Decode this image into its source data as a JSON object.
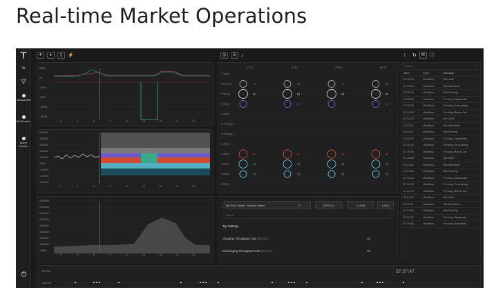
{
  "page": {
    "title": "Real-time Market Operations"
  },
  "nav": {
    "items": [
      {
        "label": "ffa"
      },
      {
        "label": "Manual Bid"
      },
      {
        "label": "Bid Monitor"
      },
      {
        "label": "Alarm Monitor"
      }
    ]
  },
  "chart_top": {
    "ylabels": [
      "800$",
      "0$",
      "-400$",
      "-800$",
      "-1200$",
      "-1600$"
    ],
    "xlabels": [
      "0",
      "3",
      "6",
      "9",
      "12",
      "15",
      "18",
      "21",
      "24"
    ]
  },
  "chart_mid": {
    "ylabels": [
      "500MW",
      "400MW",
      "300MW",
      "200MW",
      "100MW",
      "0MW",
      "-100MW",
      "-200MW",
      "-300MW"
    ],
    "xlabels": [
      "0",
      "3",
      "6",
      "9",
      "12",
      "15",
      "18",
      "21",
      "24"
    ]
  },
  "chart_bottom": {
    "ylabels": [
      "800MWh",
      "700MWh",
      "600MWh",
      "500MWh",
      "400MWh",
      "300MWh",
      "200MWh",
      "100MWh",
      "0MWh"
    ],
    "xlabels": [
      "0",
      "3",
      "6",
      "9",
      "12",
      "15",
      "18",
      "21",
      "24"
    ]
  },
  "bid_grid": {
    "columns": [
      "07:30",
      "07:45",
      "07:45",
      "08:00"
    ],
    "rows": [
      "S Soc(-)",
      "P/Pmax(-)",
      "P/Soc(-)",
      "S avg(-)",
      "S avg(-)",
      "E energy(-)",
      "E energy(-)",
      "L avg(-)",
      "L avg(-)",
      "L Soc(-)",
      "L Soc(-)",
      "L Soc(-)"
    ],
    "cells": [
      {
        "r": 1,
        "v": [
          "-1",
          "14",
          "-1",
          "14"
        ]
      },
      {
        "r": 2,
        "v": [
          "62",
          "63",
          "63",
          "63"
        ]
      },
      {
        "r": 3,
        "v": [
          "",
          "30",
          "",
          "30"
        ]
      },
      {
        "r": 8,
        "v": [
          "40",
          "40",
          "40",
          "40"
        ]
      },
      {
        "r": 9,
        "v": [
          "40",
          "40",
          "40",
          "40"
        ]
      },
      {
        "r": 10,
        "v": [
          "15",
          "15",
          "15",
          "15"
        ]
      }
    ]
  },
  "scenario": {
    "select": "Bid SOC Name - Normal Period",
    "select_suffix": "R",
    "spread": "SPREAD",
    "clear": "CLEAR",
    "save": "SAVE",
    "search_placeholder": "Search",
    "top_settings": "Top Settings",
    "settings": [
      {
        "label": "Charging Throughput Cost",
        "unit": "($/MWh)",
        "value": "20"
      },
      {
        "label": "Discharging Throughput Cost",
        "unit": "($/MWh)",
        "value": "20"
      }
    ]
  },
  "log": {
    "search_placeholder": "Search",
    "headers": [
      "Time",
      "Type",
      "Message"
    ],
    "rows": [
      [
        "07:39:53",
        "Workflow",
        "Bid Valid"
      ],
      [
        "07:39:43",
        "Workflow",
        "Bid Submitted"
      ],
      [
        "07:39:38",
        "Workflow",
        "Bid Pending"
      ],
      [
        "07:38:26",
        "Workflow",
        "Pending Optimizatio"
      ],
      [
        "07:35:25",
        "Workflow",
        "Pending Forecasting"
      ],
      [
        "07:34:39",
        "Workflow",
        "Pending Market Dat"
      ],
      [
        "07:33:22",
        "Workflow",
        "Bid Valid"
      ],
      [
        "07:33:11",
        "Workflow",
        "Bid Submitted"
      ],
      [
        "07:33:07",
        "Workflow",
        "Bid Pending"
      ],
      [
        "07:30:26",
        "Workflow",
        "Pending Optimizatio"
      ],
      [
        "07:30:25",
        "Workflow",
        "Pending Forecasting"
      ],
      [
        "07:29:50",
        "Workflow",
        "Pending Market Dat"
      ],
      [
        "07:25:56",
        "Workflow",
        "Bid Valid"
      ],
      [
        "07:25:45",
        "Workflow",
        "Bid Submitted"
      ],
      [
        "07:24:29",
        "Workflow",
        "Bid Pending"
      ],
      [
        "07:20:25",
        "Workflow",
        "Pending Optimizatio"
      ],
      [
        "07:20:26",
        "Workflow",
        "Pending Forecasting"
      ],
      [
        "07:24:20",
        "Workflow",
        "Pending Market Dat"
      ],
      [
        "07:21:22",
        "Workflow",
        "Bid Valid"
      ],
      [
        "07:20:11",
        "Workflow",
        "Bid Submitted"
      ],
      [
        "07:20:06",
        "Workflow",
        "Bid Pending"
      ],
      [
        "07:20:26",
        "Workflow",
        "Pending Optimizatio"
      ],
      [
        "07:20:26",
        "Workflow",
        "Pending Forecastin"
      ]
    ]
  },
  "timeline": {
    "labels": [
      "100 RM",
      "-100 RM"
    ],
    "clock": "07:37:47"
  },
  "colors": {
    "accent_teal": "#3aa88a",
    "accent_red": "#d64a2b",
    "accent_purple": "#6a5acd",
    "accent_cyan": "#5ec8e0"
  }
}
